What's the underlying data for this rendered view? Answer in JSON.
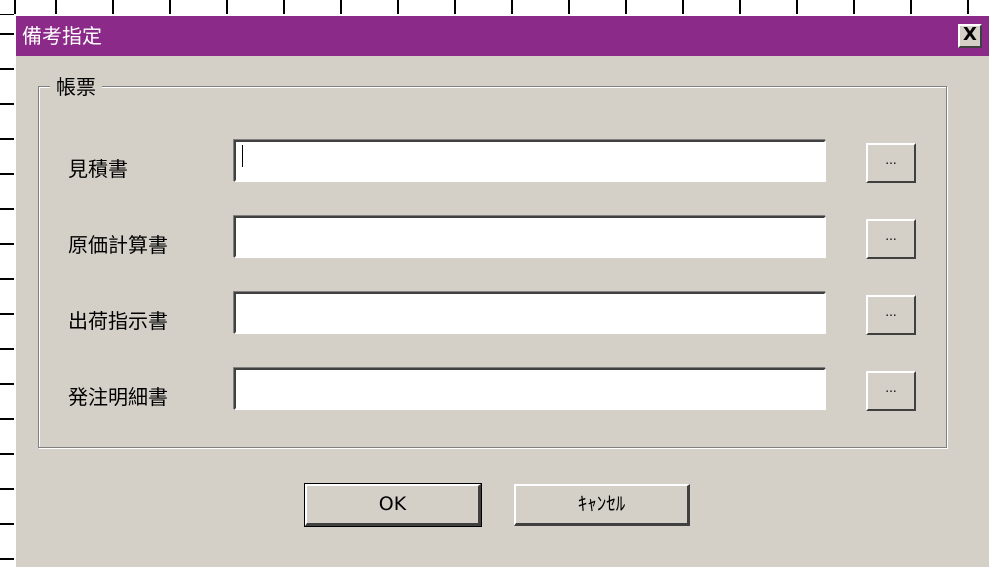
{
  "window": {
    "title": "備考指定",
    "close_label": "X"
  },
  "colors": {
    "titlebar": "#8b2a88",
    "dialog_bg": "#d4d0c8"
  },
  "group": {
    "legend": "帳票",
    "rows": [
      {
        "label": "見積書",
        "value": "",
        "browse_label": "..."
      },
      {
        "label": "原価計算書",
        "value": "",
        "browse_label": "..."
      },
      {
        "label": "出荷指示書",
        "value": "",
        "browse_label": "..."
      },
      {
        "label": "発注明細書",
        "value": "",
        "browse_label": "..."
      }
    ]
  },
  "buttons": {
    "ok_label": "OK",
    "cancel_label": "ｷｬﾝｾﾙ"
  }
}
